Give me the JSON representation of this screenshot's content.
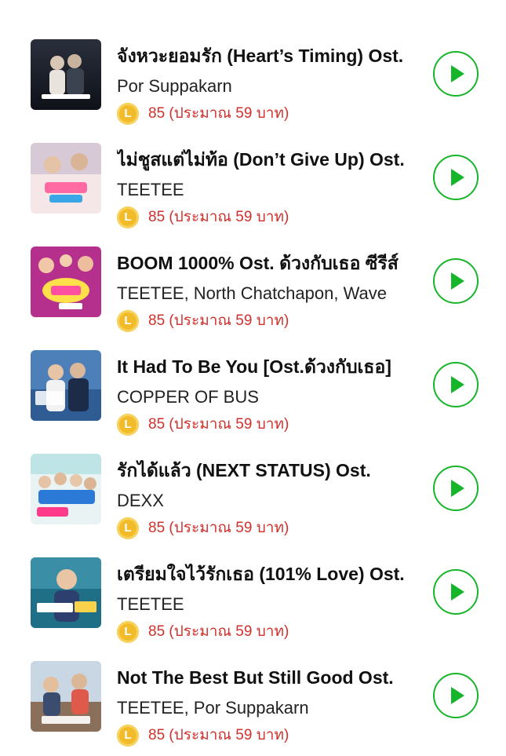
{
  "colors": {
    "accent_green": "#16b52a",
    "price_red": "#d0312d",
    "coin_gold": "#f2bb2a"
  },
  "coin_label": "L",
  "icons": {
    "play": "play-icon",
    "coin": "line-coin-icon"
  },
  "tracks": [
    {
      "title": "จังหวะยอมรัก (Heart’s Timing) Ost.",
      "artist": "Por Suppakarn",
      "price": "85 (ประมาณ 59 บาท)"
    },
    {
      "title": "ไม่ชูสแต่ไม่ท้อ (Don’t Give Up) Ost.",
      "artist": "TEETEE",
      "price": "85 (ประมาณ 59 บาท)"
    },
    {
      "title": "BOOM 1000% Ost. ด้วงกับเธอ ซีรีส์",
      "artist": "TEETEE, North Chatchapon, Wave",
      "price": "85 (ประมาณ 59 บาท)"
    },
    {
      "title": "It Had To Be You [Ost.ด้วงกับเธอ]",
      "artist": "COPPER OF BUS",
      "price": "85 (ประมาณ 59 บาท)"
    },
    {
      "title": "รักได้แล้ว (NEXT STATUS) Ost.",
      "artist": "DEXX",
      "price": "85 (ประมาณ 59 บาท)"
    },
    {
      "title": "เตรียมใจไว้รักเธอ (101% Love) Ost.",
      "artist": "TEETEE",
      "price": "85 (ประมาณ 59 บาท)"
    },
    {
      "title": "Not The Best But Still Good Ost.",
      "artist": "TEETEE, Por Suppakarn",
      "price": "85 (ประมาณ 59 บาท)"
    }
  ]
}
